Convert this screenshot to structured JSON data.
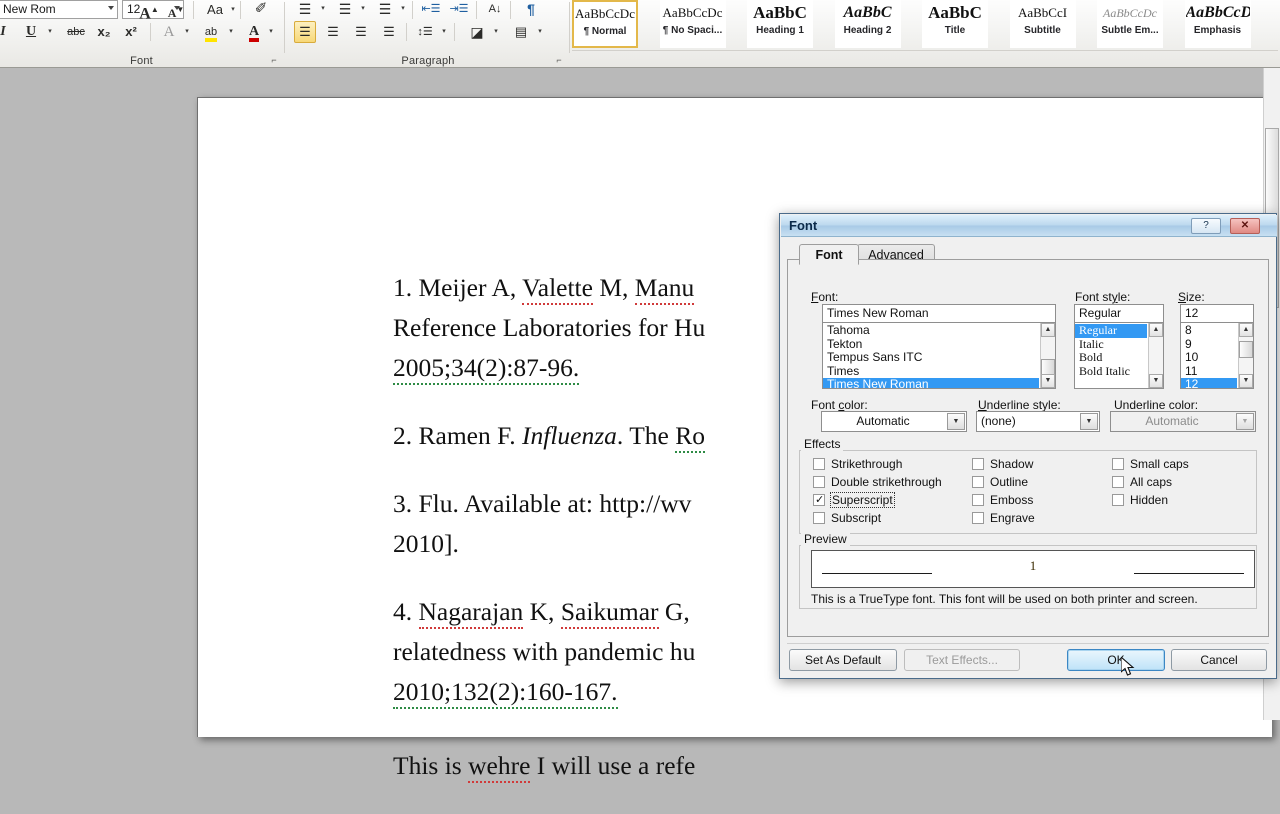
{
  "ribbon": {
    "font_group": {
      "label": "Font",
      "font_name_value": "New Rom",
      "font_size_value": "12",
      "buttons": [
        {
          "name": "grow-font",
          "glyph": "A"
        },
        {
          "name": "shrink-font",
          "glyph": "A"
        },
        {
          "name": "change-case",
          "glyph": "Aa"
        },
        {
          "name": "clear-formatting",
          "glyph": "✐"
        },
        {
          "name": "italic",
          "glyph": "I"
        },
        {
          "name": "underline",
          "glyph": "U"
        },
        {
          "name": "strikethrough",
          "glyph": "abc"
        },
        {
          "name": "subscript",
          "glyph": "x₂"
        },
        {
          "name": "superscript",
          "glyph": "x²"
        },
        {
          "name": "text-effects",
          "glyph": "A"
        },
        {
          "name": "text-highlight-color",
          "glyph": "ab"
        },
        {
          "name": "font-color",
          "glyph": "A"
        }
      ]
    },
    "paragraph_group": {
      "label": "Paragraph",
      "buttons": [
        {
          "name": "bullets",
          "glyph": "≡"
        },
        {
          "name": "numbering",
          "glyph": "≡"
        },
        {
          "name": "multilevel-list",
          "glyph": "≡"
        },
        {
          "name": "decrease-indent",
          "glyph": "←≡"
        },
        {
          "name": "increase-indent",
          "glyph": "→≡"
        },
        {
          "name": "sort",
          "glyph": "A↓"
        },
        {
          "name": "show-formatting-marks",
          "glyph": "¶"
        },
        {
          "name": "align-left",
          "glyph": "≡"
        },
        {
          "name": "align-center",
          "glyph": "≡"
        },
        {
          "name": "align-right",
          "glyph": "≡"
        },
        {
          "name": "justify",
          "glyph": "≡"
        },
        {
          "name": "line-spacing",
          "glyph": "↕≡"
        },
        {
          "name": "shading",
          "glyph": "◢"
        },
        {
          "name": "borders",
          "glyph": "▦"
        }
      ]
    },
    "styles": [
      {
        "sample": "AaBbCcDc",
        "name": "Normal",
        "marker": "¶",
        "selected": true,
        "style": "normal"
      },
      {
        "sample": "AaBbCcDc",
        "name": "No Spaci...",
        "marker": "¶",
        "selected": false,
        "style": "normal"
      },
      {
        "sample": "AaBbC",
        "name": "Heading 1",
        "marker": "",
        "selected": false,
        "style": "bold"
      },
      {
        "sample": "AaBbC",
        "name": "Heading 2",
        "marker": "",
        "selected": false,
        "style": "bolditalic"
      },
      {
        "sample": "AaBbC",
        "name": "Title",
        "marker": "",
        "selected": false,
        "style": "bold"
      },
      {
        "sample": "AaBbCcI",
        "name": "Subtitle",
        "marker": "",
        "selected": false,
        "style": "normal"
      },
      {
        "sample": "AaBbCcDc",
        "name": "Subtle Em...",
        "marker": "",
        "selected": false,
        "style": "italic-gray"
      },
      {
        "sample": "AaBbCcDc",
        "name": "Emphasis",
        "marker": "",
        "selected": false,
        "style": "bolditalic"
      }
    ]
  },
  "document": {
    "paragraphs": [
      "1. Meijer A, Valette M, Manu",
      "Reference Laboratories for Hu",
      "2005;34(2):87-96.",
      "2. Ramen F. Influenza. The Ro",
      "3.   Flu. Available at: http://wv",
      "2010].",
      "4. Nagarajan K, Saikumar G, ",
      "relatedness with pandemic hu",
      "2010;132(2):160-167.",
      "This is wehre I will use a refe"
    ]
  },
  "dialog": {
    "title": "Font",
    "help_button": "?",
    "close_button": "✕",
    "tabs": [
      {
        "label": "Font",
        "active": true
      },
      {
        "label": "Advanced",
        "active": false
      }
    ],
    "font_label": "Font:",
    "font_value": "Times New Roman",
    "font_list": [
      "Tahoma",
      "Tekton",
      "Tempus Sans ITC",
      "Times",
      "Times New Roman"
    ],
    "font_list_selected": "Times New Roman",
    "style_label": "Font style:",
    "style_value": "Regular",
    "style_list": [
      "Regular",
      "Italic",
      "Bold",
      "Bold Italic"
    ],
    "style_list_selected": "Regular",
    "size_label": "Size:",
    "size_value": "12",
    "size_list": [
      "8",
      "9",
      "10",
      "11",
      "12"
    ],
    "size_list_selected": "12",
    "font_color_label": "Font color:",
    "font_color_value": "Automatic",
    "underline_style_label": "Underline style:",
    "underline_style_value": "(none)",
    "underline_color_label": "Underline color:",
    "underline_color_value": "Automatic",
    "underline_color_disabled": true,
    "effects_label": "Effects",
    "effects": [
      {
        "label": "Strikethrough",
        "checked": false,
        "focused": false
      },
      {
        "label": "Double strikethrough",
        "checked": false,
        "focused": false
      },
      {
        "label": "Superscript",
        "checked": true,
        "focused": true
      },
      {
        "label": "Subscript",
        "checked": false,
        "focused": false
      },
      {
        "label": "Shadow",
        "checked": false,
        "focused": false
      },
      {
        "label": "Outline",
        "checked": false,
        "focused": false
      },
      {
        "label": "Emboss",
        "checked": false,
        "focused": false
      },
      {
        "label": "Engrave",
        "checked": false,
        "focused": false
      },
      {
        "label": "Small caps",
        "checked": false,
        "focused": false
      },
      {
        "label": "All caps",
        "checked": false,
        "focused": false
      },
      {
        "label": "Hidden",
        "checked": false,
        "focused": false
      }
    ],
    "preview_label": "Preview",
    "preview_text": "1",
    "truetype_note": "This is a TrueType font. This font will be used on both printer and screen.",
    "buttons": {
      "set_as_default": "Set As Default",
      "text_effects": "Text Effects...",
      "ok": "OK",
      "cancel": "Cancel"
    }
  },
  "colors": {
    "accent": "#3399f3",
    "titlebar": "#a8cae6",
    "close_red": "#e08a84",
    "highlight_gold": "#f7d878",
    "spell_red": "#d03a3a",
    "grammar_green": "#2e8b45"
  }
}
